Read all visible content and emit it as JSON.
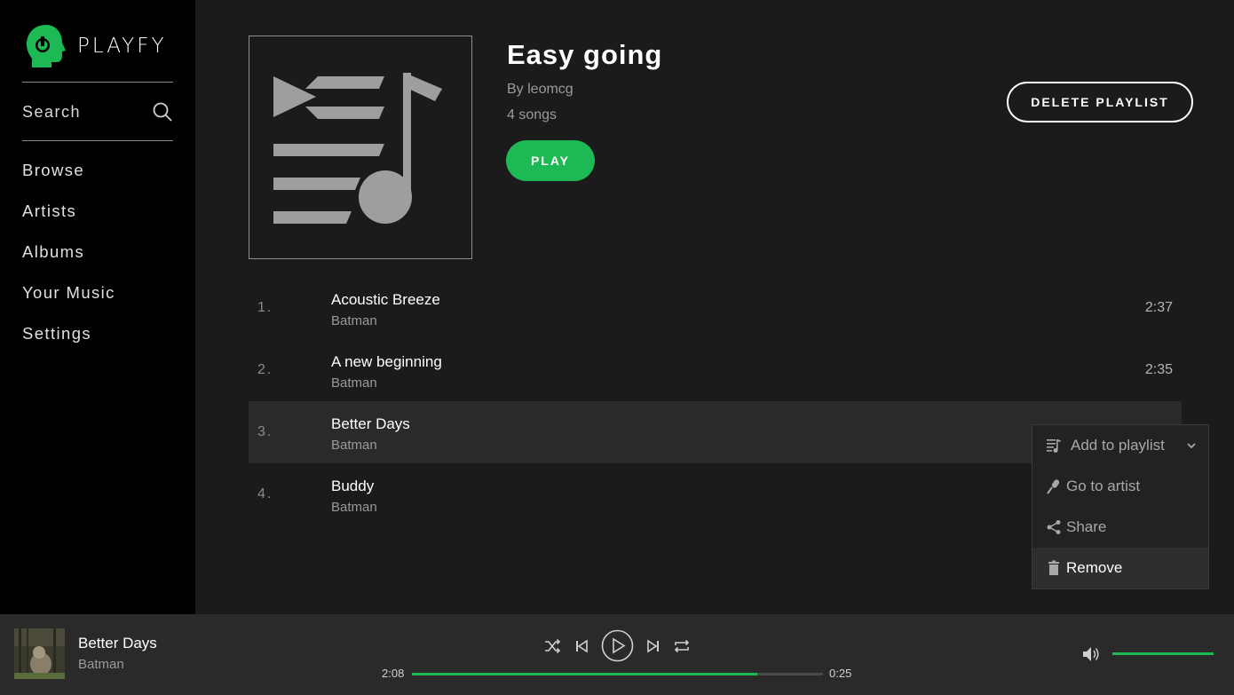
{
  "app": {
    "name": "PLAYFY",
    "brand_color": "#1db954"
  },
  "sidebar": {
    "search_label": "Search",
    "nav": [
      {
        "label": "Browse"
      },
      {
        "label": "Artists"
      },
      {
        "label": "Albums"
      },
      {
        "label": "Your Music"
      },
      {
        "label": "Settings"
      }
    ]
  },
  "playlist": {
    "title": "Easy going",
    "owner": "By leomcg",
    "song_count": "4 songs",
    "play_label": "PLAY",
    "delete_label": "DELETE PLAYLIST",
    "cover_icon": "playlist-music-icon"
  },
  "tracks": [
    {
      "number": "1.",
      "title": "Acoustic Breeze",
      "artist": "Batman",
      "duration": "2:37"
    },
    {
      "number": "2.",
      "title": "A new beginning",
      "artist": "Batman",
      "duration": "2:35"
    },
    {
      "number": "3.",
      "title": "Better Days",
      "artist": "Batman",
      "duration": ""
    },
    {
      "number": "4.",
      "title": "Buddy",
      "artist": "Batman",
      "duration": ""
    }
  ],
  "context_menu": {
    "items": [
      {
        "label": "Add to playlist",
        "icon": "playlist-add-icon"
      },
      {
        "label": "Go to artist",
        "icon": "microphone-icon"
      },
      {
        "label": "Share",
        "icon": "share-icon"
      },
      {
        "label": "Remove",
        "icon": "trash-icon"
      }
    ]
  },
  "player": {
    "title": "Better Days",
    "artist": "Batman",
    "elapsed": "2:08",
    "remaining": "0:25",
    "progress_fraction": 0.84,
    "volume_fraction": 1.0
  }
}
